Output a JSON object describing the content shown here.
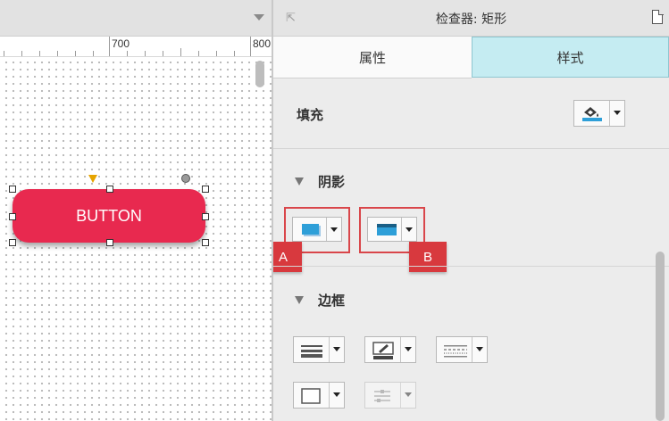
{
  "canvas": {
    "ruler_labels": [
      "700",
      "800"
    ],
    "widget_label": "BUTTON",
    "widget_color": "#e8294f"
  },
  "inspector": {
    "title": "检查器: 矩形",
    "tabs": [
      {
        "label": "属性",
        "active": false
      },
      {
        "label": "样式",
        "active": true
      }
    ],
    "fill": {
      "label": "填充",
      "icon": "paint-bucket-icon"
    },
    "shadow": {
      "label": "阴影",
      "outer_icon": "outer-shadow-icon",
      "inner_icon": "inner-shadow-icon"
    },
    "border": {
      "label": "边框",
      "icons": [
        "line-weight-icon",
        "line-color-icon",
        "line-style-icon",
        "corner-radius-icon",
        "arrow-style-icon"
      ]
    },
    "callouts": [
      "A",
      "B"
    ],
    "accent_color": "#c5ecf2",
    "callout_color": "#d8393e"
  }
}
